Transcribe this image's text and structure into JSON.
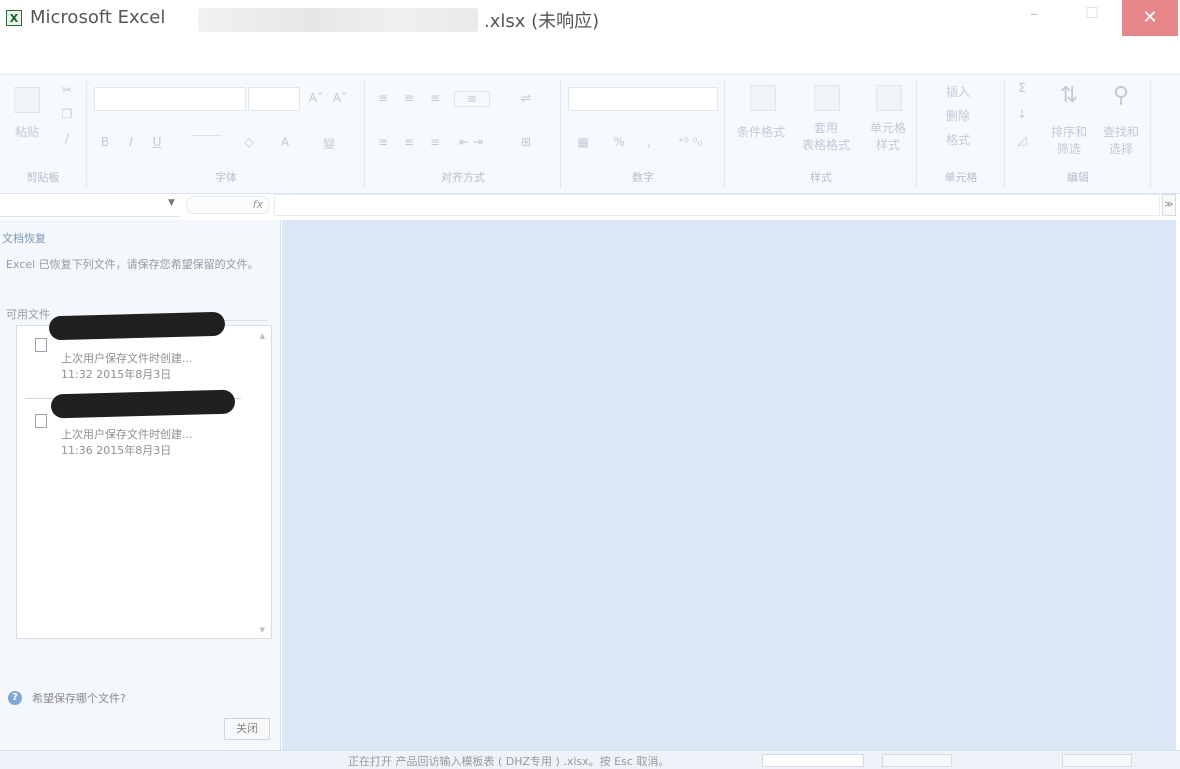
{
  "titlebar": {
    "app_icon": "excel-icon",
    "app_name": "Microsoft Excel",
    "file_title": ".xlsx (未响应)",
    "minimize": "–",
    "maximize": "□",
    "close": "✕"
  },
  "ribbon": {
    "clipboard": {
      "label": "剪贴板",
      "paste": "粘贴"
    },
    "font": {
      "label": "字体",
      "bold": "B",
      "italic": "I",
      "underline": "U",
      "grow": "A˄",
      "shrink": "A˅",
      "font_color": "A",
      "wen": "變"
    },
    "alignment": {
      "label": "对齐方式"
    },
    "number": {
      "label": "数字",
      "percent": "%",
      "comma": ","
    },
    "styles": {
      "label": "样式",
      "conditional": "条件格式",
      "table": "套用\n表格格式",
      "cell_styles": "单元格\n样式"
    },
    "cells": {
      "label": "单元格",
      "insert": "插入",
      "delete": "删除",
      "format": "格式"
    },
    "editing": {
      "label": "编辑",
      "sum": "Σ",
      "sort": "排序和\n筛选",
      "find": "查找和\n选择"
    }
  },
  "formula_bar": {
    "fx": "fx",
    "expand": "≫"
  },
  "recovery_pane": {
    "title": "文档恢复",
    "description": "Excel 已恢复下列文件，请保存您希望保留的文件。",
    "available_label": "可用文件",
    "files": [
      {
        "description": "上次用户保存文件时创建...",
        "time": "11:32 2015年8月3日"
      },
      {
        "description": "上次用户保存文件时创建...",
        "time": "11:36 2015年8月3日"
      }
    ],
    "help_text": "希望保存哪个文件?",
    "close_button": "关闭"
  },
  "statusbar": {
    "text": "正在打开 产品回访输入模板表 ( DHZ专用 ) .xlsx。按 Esc 取消。"
  },
  "colors": {
    "workspace": "#dbe7f5",
    "close_button": "#e8878a",
    "ribbon": "#f6f9fd"
  }
}
